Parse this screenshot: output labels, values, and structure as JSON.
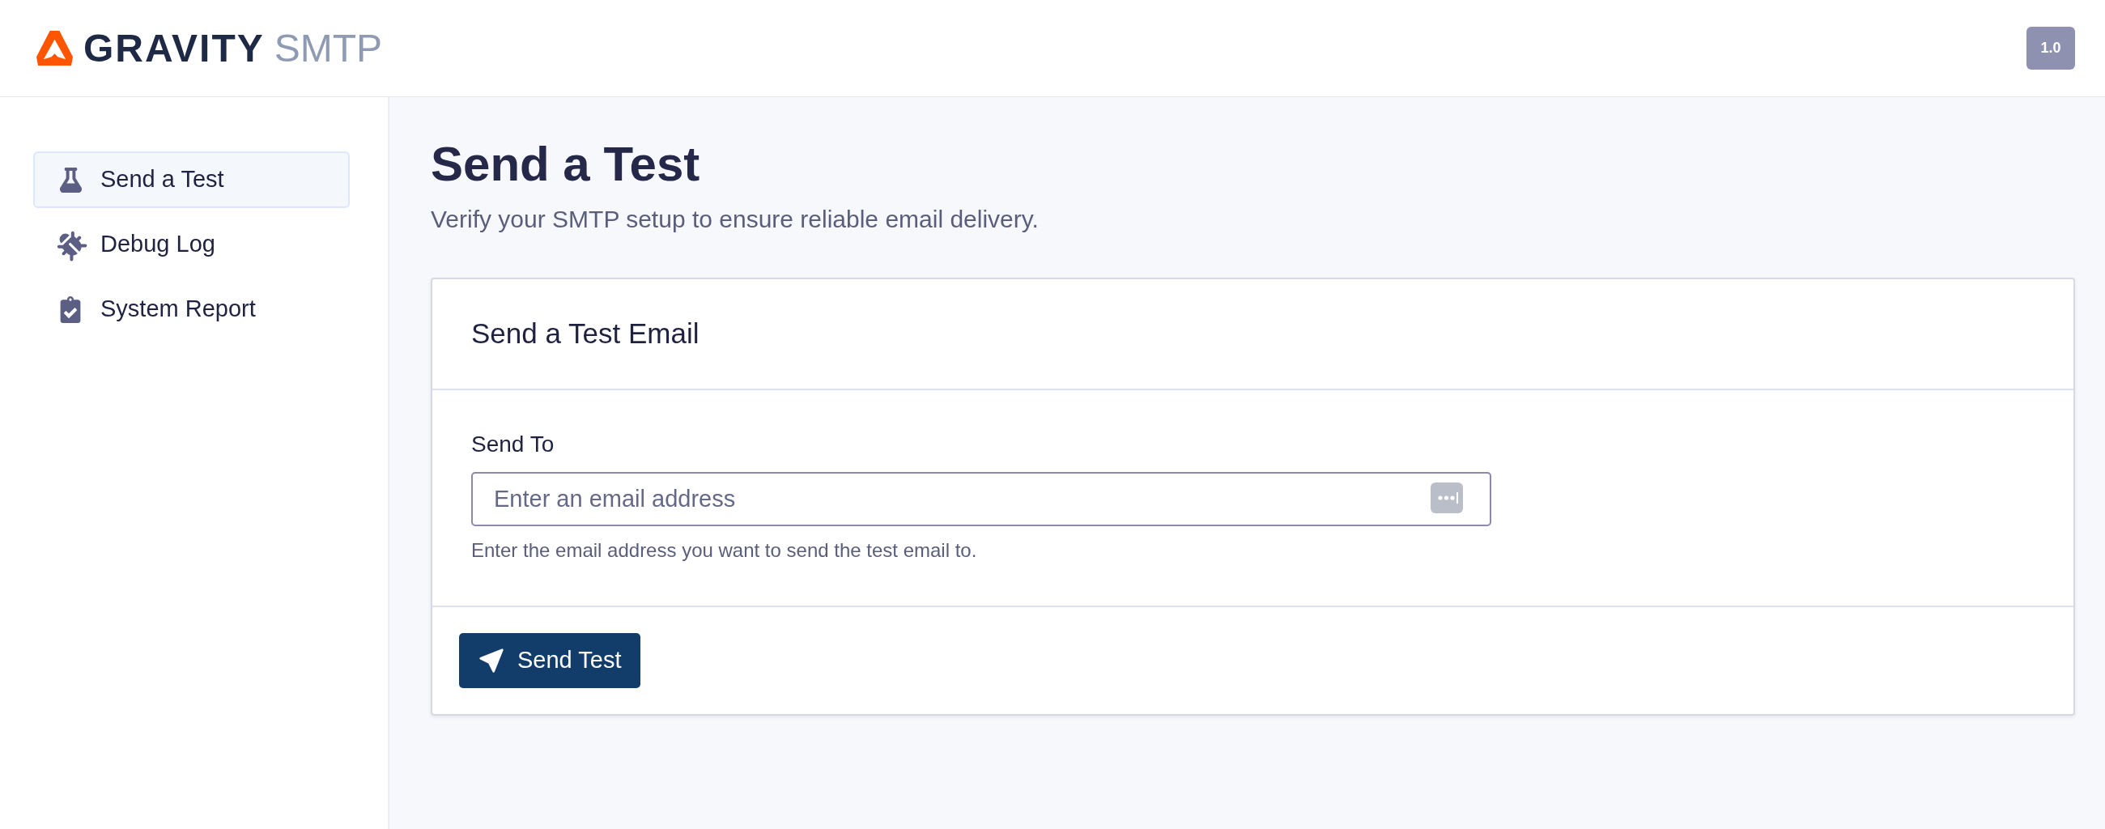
{
  "header": {
    "logo": {
      "brand": "GRAVITY",
      "product": "SMTP"
    },
    "version": "1.0"
  },
  "sidebar": {
    "items": [
      {
        "label": "Send a Test",
        "selected": true
      },
      {
        "label": "Debug Log",
        "selected": false
      },
      {
        "label": "System Report",
        "selected": false
      }
    ]
  },
  "page": {
    "title": "Send a Test",
    "subtitle": "Verify your SMTP setup to ensure reliable email delivery."
  },
  "card": {
    "title": "Send a Test Email",
    "field": {
      "label": "Send To",
      "placeholder": "Enter an email address",
      "help": "Enter the email address you want to send the test email to."
    },
    "button": "Send Test"
  }
}
